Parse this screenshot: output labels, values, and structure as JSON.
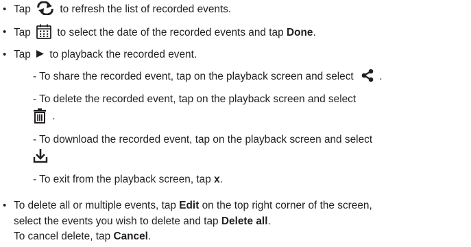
{
  "bullets": {
    "refresh": {
      "pre": "Tap",
      "post": "to refresh the list of recorded events.",
      "icon": "refresh-icon"
    },
    "calendar": {
      "pre": "Tap",
      "post": "to select the date of the recorded events and tap",
      "bold": "Done",
      "end": ".",
      "icon": "calendar-icon"
    },
    "play": {
      "pre": "Tap",
      "post": "to playback the recorded event.",
      "icon": "play-icon"
    },
    "share": {
      "text": "- To share the recorded event, tap on the playback screen and select",
      "end": ".",
      "icon": "share-icon"
    },
    "delete": {
      "text": "- To delete the recorded event, tap on the playback screen and select",
      "end": ".",
      "icon": "trash-icon"
    },
    "download": {
      "text": "- To download the recorded event, tap on the playback screen and select",
      "icon": "download-icon"
    },
    "exit": {
      "text": "- To exit from the playback screen, tap",
      "bold": "x",
      "end": "."
    },
    "multi": {
      "l1_pre": "To delete all or multiple events, tap",
      "l1_bold": "Edit",
      "l1_post": "on the top right corner of the screen,",
      "l2_pre": "select the events you wish to delete and tap",
      "l2_bold": "Delete all",
      "l2_end": ".",
      "l3_pre": "To cancel delete, tap",
      "l3_bold": "Cancel",
      "l3_end": "."
    }
  },
  "bullet_char": "•",
  "colors": {
    "text": "#231f20"
  }
}
